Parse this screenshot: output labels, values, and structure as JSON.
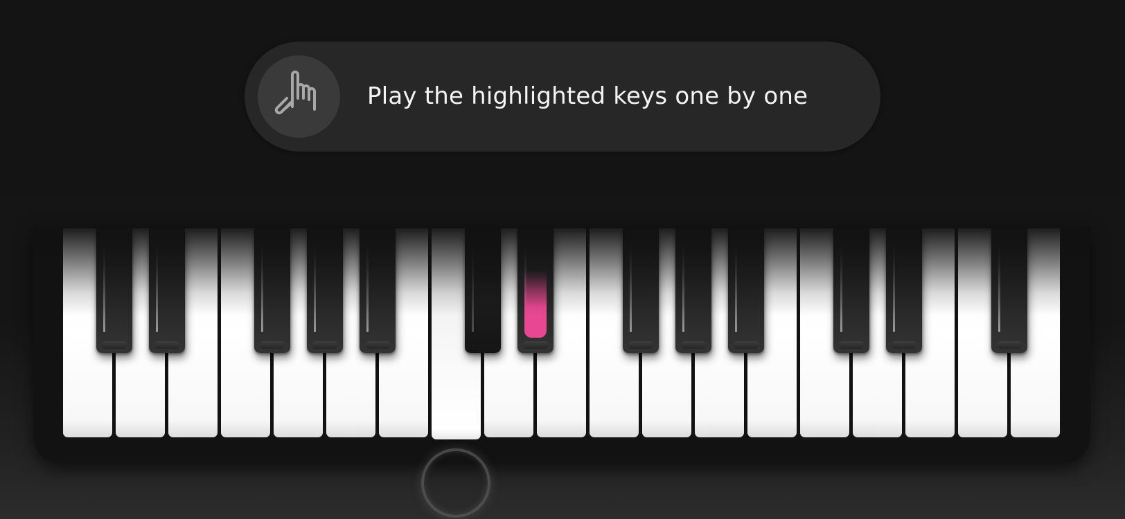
{
  "prompt": {
    "text": "Play the highlighted keys one by one",
    "icon": "tap-hand-icon"
  },
  "keyboard": {
    "white_key_count": 19,
    "black_key_count": 13,
    "pressed_white_key": 7,
    "pressed_black_key": 5,
    "highlighted_black_key": 6
  },
  "colors": {
    "background": "#141414",
    "highlight": "#e84891",
    "prompt_bg": "#272727"
  }
}
